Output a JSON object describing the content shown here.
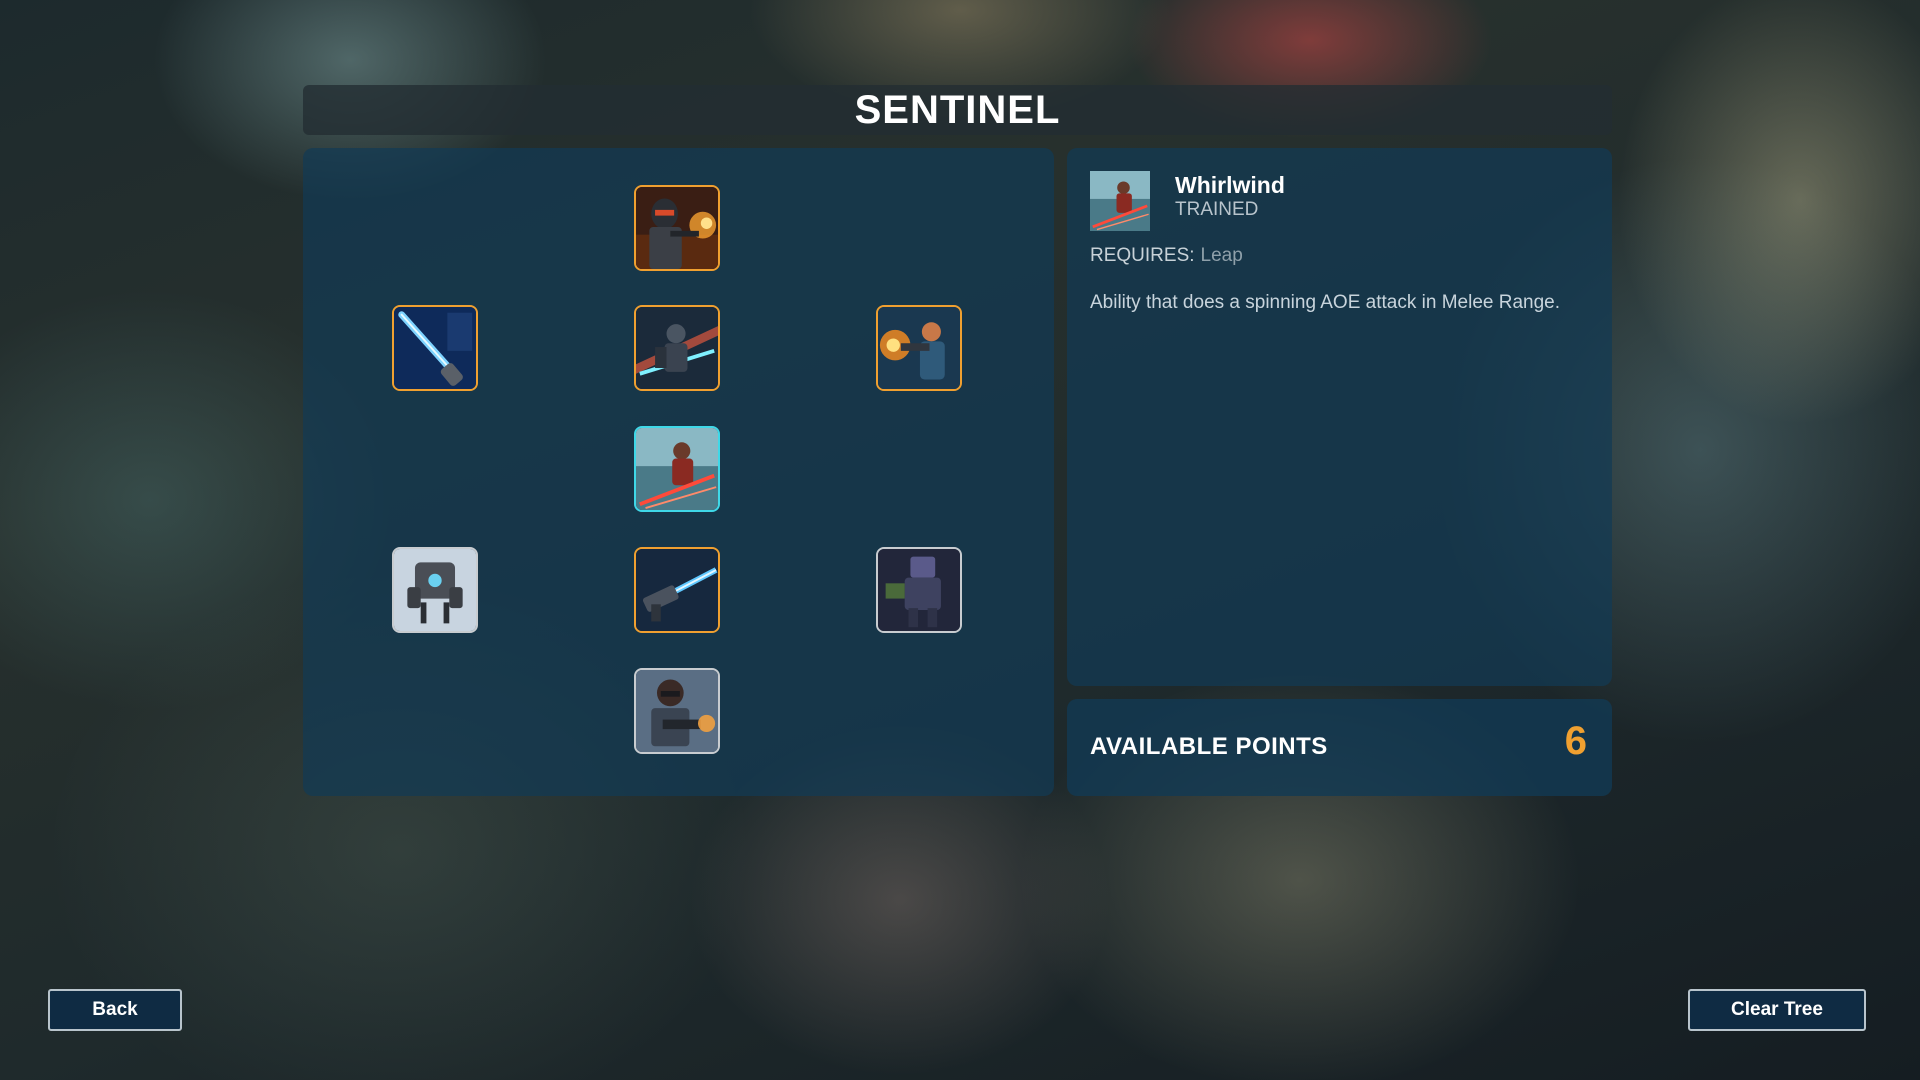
{
  "title": "SENTINEL",
  "tree": {
    "nodes": [
      {
        "id": "node-1",
        "state": "orange",
        "icon": "armored-soldier-firing-icon"
      },
      {
        "id": "node-2",
        "state": "orange",
        "icon": "blue-energy-blade-icon"
      },
      {
        "id": "node-3",
        "state": "orange",
        "icon": "mech-warrior-slash-icon"
      },
      {
        "id": "node-4",
        "state": "orange",
        "icon": "soldier-firing-blaster-icon"
      },
      {
        "id": "node-5",
        "state": "cyan",
        "icon": "whirlwind-icon"
      },
      {
        "id": "node-6",
        "state": "grey",
        "icon": "combat-drone-icon"
      },
      {
        "id": "node-7",
        "state": "orange",
        "icon": "plasma-rifle-icon"
      },
      {
        "id": "node-8",
        "state": "grey",
        "icon": "heavy-mech-icon"
      },
      {
        "id": "node-9",
        "state": "grey",
        "icon": "masked-gunner-icon"
      }
    ]
  },
  "detail": {
    "icon": "whirlwind-icon",
    "name": "Whirlwind",
    "status": "TRAINED",
    "requires_label": "REQUIRES:",
    "requires_value": "Leap",
    "description": "Ability that does a spinning AOE attack in Melee Range."
  },
  "points": {
    "label": "AVAILABLE POINTS",
    "value": "6"
  },
  "buttons": {
    "back": "Back",
    "clear_tree": "Clear Tree"
  },
  "colors": {
    "accent_orange": "#f0a030",
    "accent_cyan": "#3fd8e8",
    "panel_blue": "#123a54"
  }
}
